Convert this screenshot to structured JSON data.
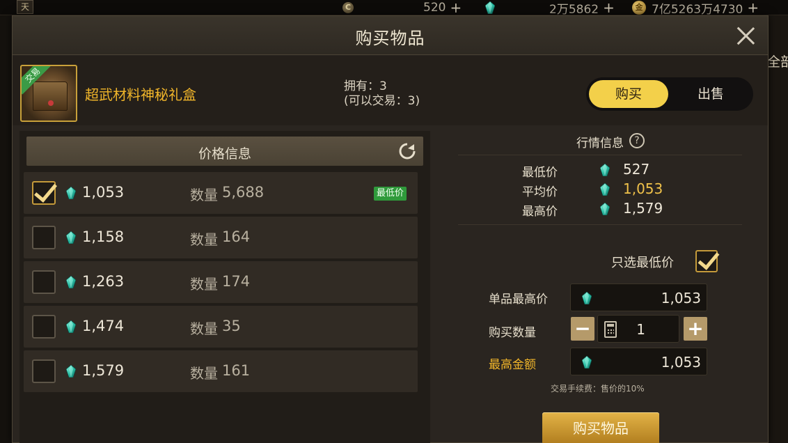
{
  "topbar": {
    "corner_glyph": "天",
    "currency1": {
      "icon": "c-coin-icon",
      "glyph": "C",
      "value": "520",
      "plus": "+"
    },
    "currency2": {
      "icon": "gem-icon",
      "value": "2万5862",
      "plus": "+"
    },
    "currency3": {
      "icon": "gold-coin-icon",
      "glyph": "金",
      "value": "7亿5263万4730",
      "plus": "+"
    }
  },
  "background": {
    "right_edge_text": "全部"
  },
  "modal": {
    "title": "购买物品",
    "item": {
      "name": "超武材料神秘礼盒",
      "tag": "交易",
      "owned_line": "拥有：3",
      "tradable_line": "(可以交易：3)"
    },
    "mode": {
      "buy": "购买",
      "sell": "出售",
      "selected": "buy"
    },
    "price_info": {
      "title": "价格信息",
      "qty_label": "数量",
      "lowest_badge": "最低价",
      "rows": [
        {
          "price": "1,053",
          "qty": "5,688",
          "checked": true,
          "lowest": true
        },
        {
          "price": "1,158",
          "qty": "164",
          "checked": false,
          "lowest": false
        },
        {
          "price": "1,263",
          "qty": "174",
          "checked": false,
          "lowest": false
        },
        {
          "price": "1,474",
          "qty": "35",
          "checked": false,
          "lowest": false
        },
        {
          "price": "1,579",
          "qty": "161",
          "checked": false,
          "lowest": false
        }
      ]
    },
    "market": {
      "title": "行情信息",
      "help_glyph": "?",
      "min_label": "最低价",
      "min_value": "527",
      "avg_label": "平均价",
      "avg_value": "1,053",
      "max_label": "最高价",
      "max_value": "1,579"
    },
    "form": {
      "only_lowest_label": "只选最低价",
      "only_lowest_checked": true,
      "unit_max_label": "单品最高价",
      "unit_max_value": "1,053",
      "qty_label": "购买数量",
      "qty_value": "1",
      "minus": "−",
      "plus": "+",
      "total_label": "最高金额",
      "total_value": "1,053",
      "fee_note": "交易手续费：售价的10%",
      "buy_button": "购买物品"
    }
  },
  "colors": {
    "accent_gold": "#f0b52a",
    "toggle_yellow": "#f3d04a",
    "badge_green": "#2f9a3b",
    "gem_teal": "#2ec2a8"
  }
}
